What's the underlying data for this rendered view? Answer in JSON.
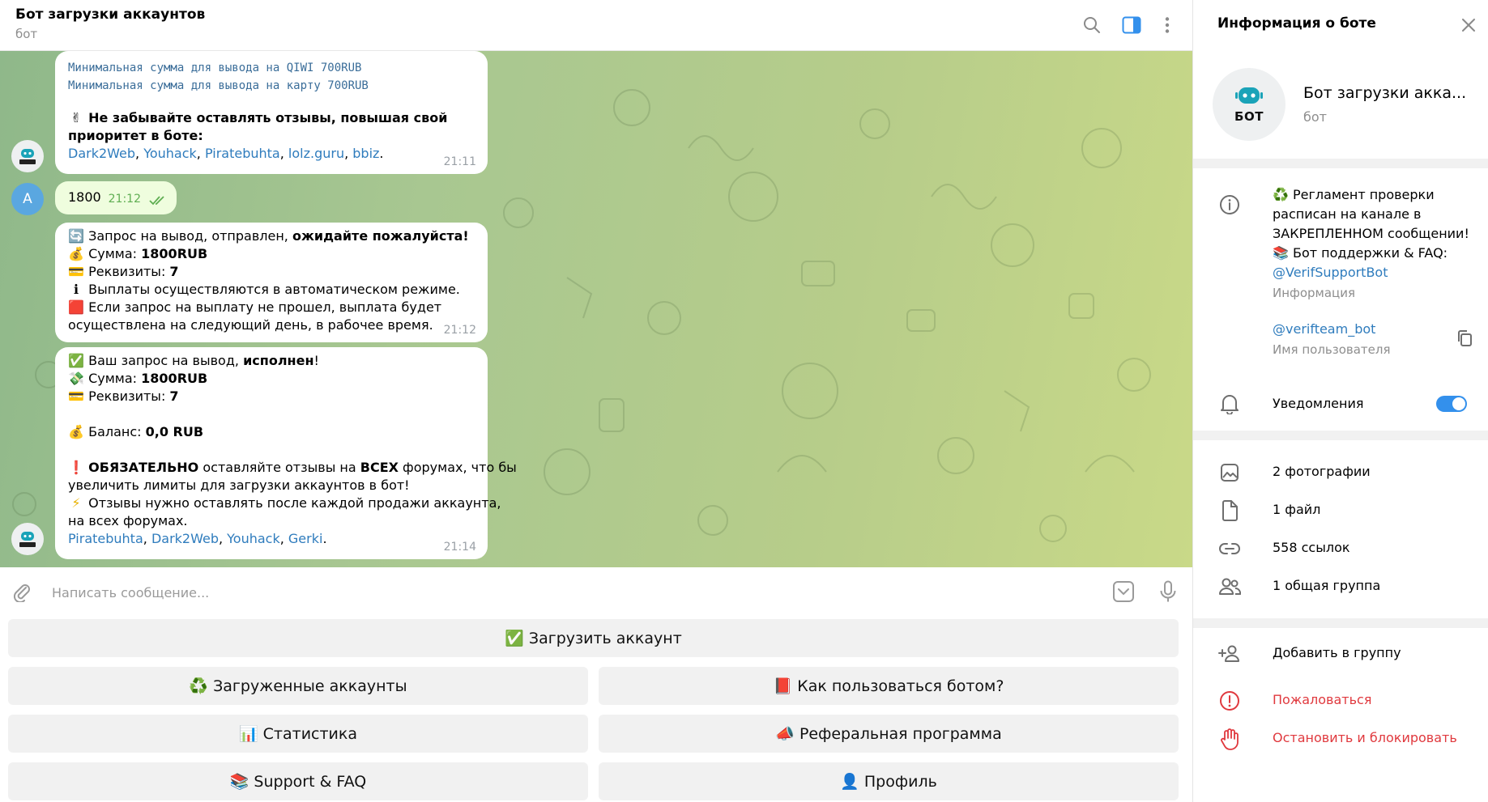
{
  "header": {
    "title": "Бот загрузки аккаунтов",
    "status": "бот"
  },
  "messages": [
    {
      "lines_mono": [
        "Минимальная сумма для вывода на QIWI 700RUB",
        "Минимальная сумма для вывода на карту 700RUB"
      ],
      "reminder_emoji": "✌",
      "reminder_line1": "Не забывайте оставлять отзывы, повышая свой",
      "reminder_line2": "приоритет в боте:",
      "links": [
        "Dark2Web",
        "Youhack",
        "Piratebuhta",
        "lolz.guru",
        "bbiz"
      ],
      "end_punct": ".",
      "time": "21:11"
    },
    {
      "text": "1800",
      "time": "21:12",
      "avatar_letter": "A"
    },
    {
      "l1_emoji": "🔄",
      "l1_text": "Запрос на вывод,  отправлен, ",
      "l1_bold": "ожидайте пожалуйста!",
      "l2_emoji": "💰",
      "l2_label": "Сумма: ",
      "l2_value": "1800RUB",
      "l3_emoji": "💳",
      "l3_label": "Реквизиты: ",
      "l3_value": "7",
      "l4_emoji": "ℹ",
      "l4_text": "Выплаты осуществляются в автоматическом режиме.",
      "l5_emoji": "🟥",
      "l5_text": "Если запрос на выплату не прошел, выплата будет",
      "l6_text": "осуществлена на следующий день, в рабочее время.",
      "time": "21:12"
    },
    {
      "l1_emoji": "✅",
      "l1_text": "Ваш запрос на вывод, ",
      "l1_bold": "исполнен",
      "l1_end": "!",
      "l2_emoji": "💸",
      "l2_label": "Сумма: ",
      "l2_value": "1800RUB",
      "l3_emoji": "💳",
      "l3_label": "Реквизиты: ",
      "l3_value": "7",
      "l4_emoji": "💰",
      "l4_label": "Баланс: ",
      "l4_value": "0,0 RUB",
      "l5_emoji": "❗",
      "l5_bold1": "ОБЯЗАТЕЛЬНО",
      "l5_text1": " оставляйте отзывы на ",
      "l5_bold2": "ВСЕХ",
      "l5_text2": " форумах, что бы",
      "l6_text": "увеличить лимиты для загрузки аккаунтов в бот!",
      "l7_emoji": "⚡",
      "l7_text": "Отзывы нужно оставлять после каждой продажи аккаунта,",
      "l8_text": "на всех форумах.",
      "links": [
        "Piratebuhta",
        "Dark2Web",
        "Youhack",
        "Gerki"
      ],
      "end_punct": ".",
      "time": "21:14"
    }
  ],
  "composer": {
    "placeholder": "Написать сообщение..."
  },
  "keyboard": {
    "row1": [
      "✅ Загрузить аккаунт"
    ],
    "row2": [
      "♻️ Загруженные аккаунты",
      "📕 Как пользоваться ботом?"
    ],
    "row3": [
      "📊 Статистика",
      "📣 Реферальная программа"
    ],
    "row4": [
      "📚 Support & FAQ",
      "👤 Профиль"
    ]
  },
  "side": {
    "title": "Информация о боте",
    "bot_name": "Бот загрузки акка...",
    "bot_status": "бот",
    "avatar_text": "БОТ",
    "info_lines": [
      "♻️ Регламент проверки",
      "расписан на канале в",
      "ЗАКРЕПЛЕННОМ сообщении!",
      "📚 Бот поддержки & FAQ:"
    ],
    "info_link": "@VerifSupportBot",
    "info_label": "Информация",
    "username": "@verifteam_bot",
    "username_label": "Имя пользователя",
    "notifications": "Уведомления",
    "notifications_on": true,
    "media": [
      "2 фотографии",
      "1 файл",
      "558 ссылок",
      "1 общая группа"
    ],
    "actions": {
      "add_group": "Добавить в группу",
      "report": "Пожаловаться",
      "block": "Остановить и блокировать"
    }
  },
  "colors": {
    "accent": "#3390ec",
    "link": "#2f7cbd",
    "danger": "#e0393e",
    "outgoing_bubble": "#effdde"
  }
}
